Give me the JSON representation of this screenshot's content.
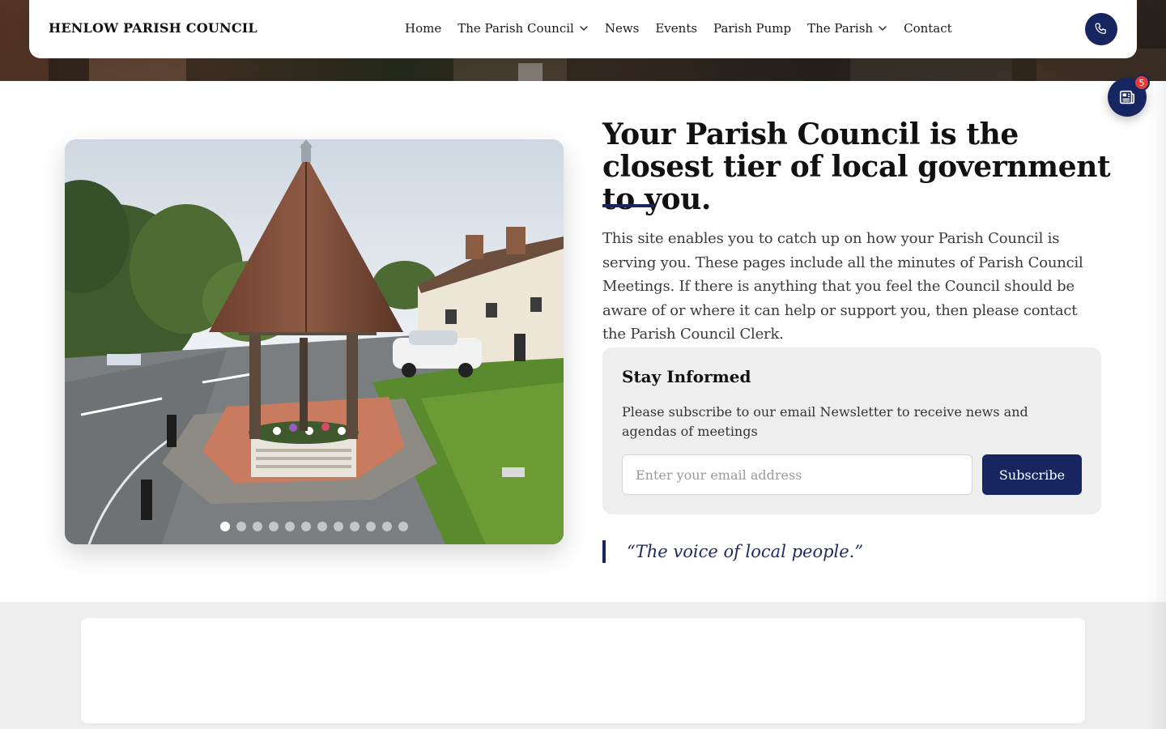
{
  "header": {
    "site_title": "HENLOW PARISH COUNCIL",
    "nav_items": [
      {
        "label": "Home",
        "has_dropdown": false
      },
      {
        "label": "The Parish Council",
        "has_dropdown": true
      },
      {
        "label": "News",
        "has_dropdown": false
      },
      {
        "label": "Events",
        "has_dropdown": false
      },
      {
        "label": "Parish Pump",
        "has_dropdown": false
      },
      {
        "label": "The Parish",
        "has_dropdown": true
      },
      {
        "label": "Contact",
        "has_dropdown": false
      }
    ],
    "phone_icon": "phone-icon"
  },
  "news_widget": {
    "icon": "newspaper-icon",
    "badge_count": "5"
  },
  "slideshow": {
    "image_description_icon": "village-pump-photo",
    "slide_count": 12,
    "active_index": 0
  },
  "intro": {
    "headline": "Your Parish Council is the closest tier of local government to you.",
    "body": "This site enables you to catch up on how your Parish Council is serving you. These pages include all the minutes of Parish Council Meetings. If there is anything that you feel the Council should be aware of or where it can help or support you, then please contact the Parish Council Clerk."
  },
  "subscribe": {
    "title": "Stay Informed",
    "text": "Please subscribe to our email Newsletter to receive news and agendas of meetings",
    "email_placeholder": "Enter your email address",
    "email_value": "",
    "button_label": "Subscribe"
  },
  "quote": {
    "text": "“The voice of local people.”"
  },
  "colors": {
    "primary": "#172561",
    "badge": "#e23b3b",
    "card_background": "#eeeeee"
  }
}
